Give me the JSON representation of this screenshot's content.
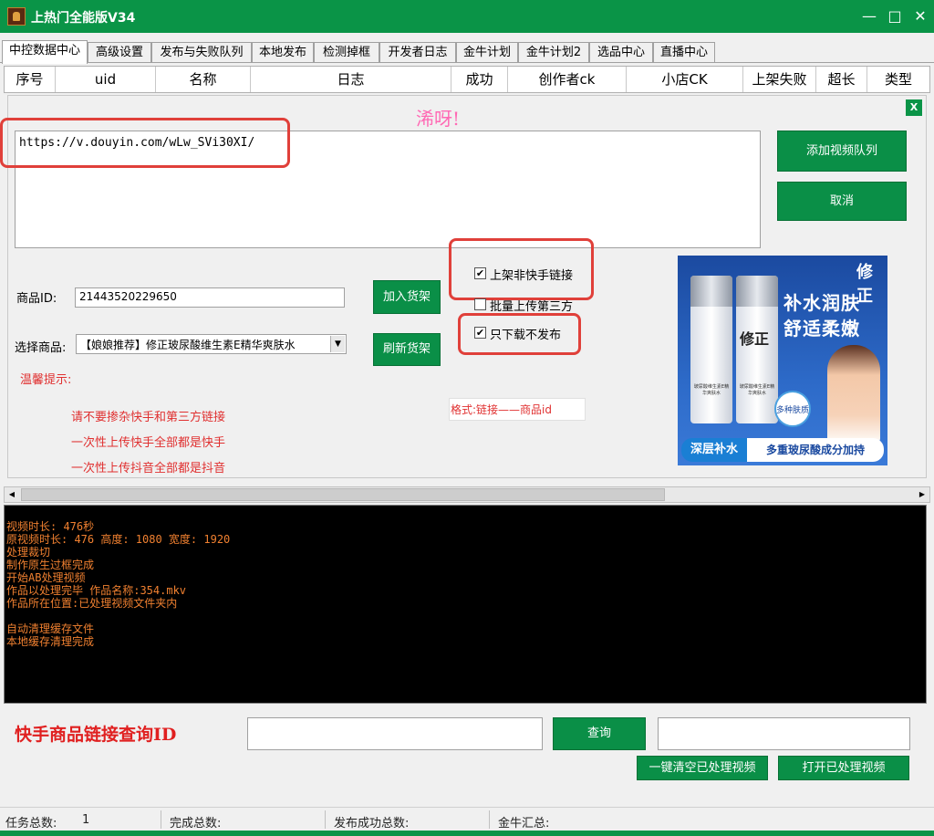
{
  "window": {
    "title": "上热门全能版V34",
    "minimize": "—",
    "maximize": "□",
    "close": "✕"
  },
  "tabs": [
    "中控数据中心",
    "高级设置",
    "发布与失败队列",
    "本地发布",
    "检测掉框",
    "开发者日志",
    "金牛计划",
    "金牛计划2",
    "选品中心",
    "直播中心"
  ],
  "grid_columns": [
    "序号",
    "uid",
    "名称",
    "日志",
    "成功",
    "创作者ck",
    "小店CK",
    "上架失败",
    "超长",
    "类型"
  ],
  "panel": {
    "title": "浠呀!",
    "close": "X",
    "url_text": "https://v.douyin.com/wLw_SVi30XI/",
    "add_queue_button": "添加视频队列",
    "cancel_button": "取消",
    "checkbox_nonks": {
      "label": "上架非快手链接",
      "checked": true,
      "mark": "✔"
    },
    "checkbox_batch": {
      "label": "批量上传第三方",
      "checked": false
    },
    "checkbox_download": {
      "label": "只下载不发布",
      "checked": true,
      "mark": "✔"
    },
    "product_id_label": "商品ID:",
    "product_id_value": "21443520229650",
    "add_shelf_button": "加入货架",
    "select_label": "选择商品:",
    "select_value": "【娘娘推荐】修正玻尿酸维生素E精华爽肤水",
    "refresh_shelf_button": "刷新货架",
    "format_hint": "格式:链接——商品id",
    "tips_title": "温馨提示:",
    "tips": [
      "请不要掺杂快手和第三方链接",
      "一次性上传快手全部都是快手",
      "一次性上传抖音全部都是抖音"
    ],
    "ad": {
      "brand": "修正",
      "slogan_1": "补水润肤",
      "slogan_2": "舒适柔嫩",
      "badge": "多种肤质",
      "bottle_label": "玻尿酸维生素E精华爽肤水",
      "footer_left": "深层补水",
      "footer_right": "多重玻尿酸成分加持"
    }
  },
  "log_lines": [
    "视频时长: 476秒",
    "原视频时长: 476 高度: 1080 宽度: 1920",
    "处理裁切",
    "制作原生过框完成",
    "开始AB处理视频",
    "作品以处理完毕 作品名称:354.mkv",
    "作品所在位置:已处理视频文件夹内",
    "",
    "自动清理缓存文件",
    "本地缓存清理完成"
  ],
  "query": {
    "label": "快手商品链接查询ID",
    "input_value": "",
    "button": "查询",
    "result_value": "",
    "clear_button": "一键清空已处理视频",
    "open_button": "打开已处理视频"
  },
  "status": {
    "task_total_label": "任务总数:",
    "task_total_value": "1",
    "done_total_label": "完成总数:",
    "publish_total_label": "发布成功总数:",
    "jinniu_total_label": "金牛汇总:"
  }
}
